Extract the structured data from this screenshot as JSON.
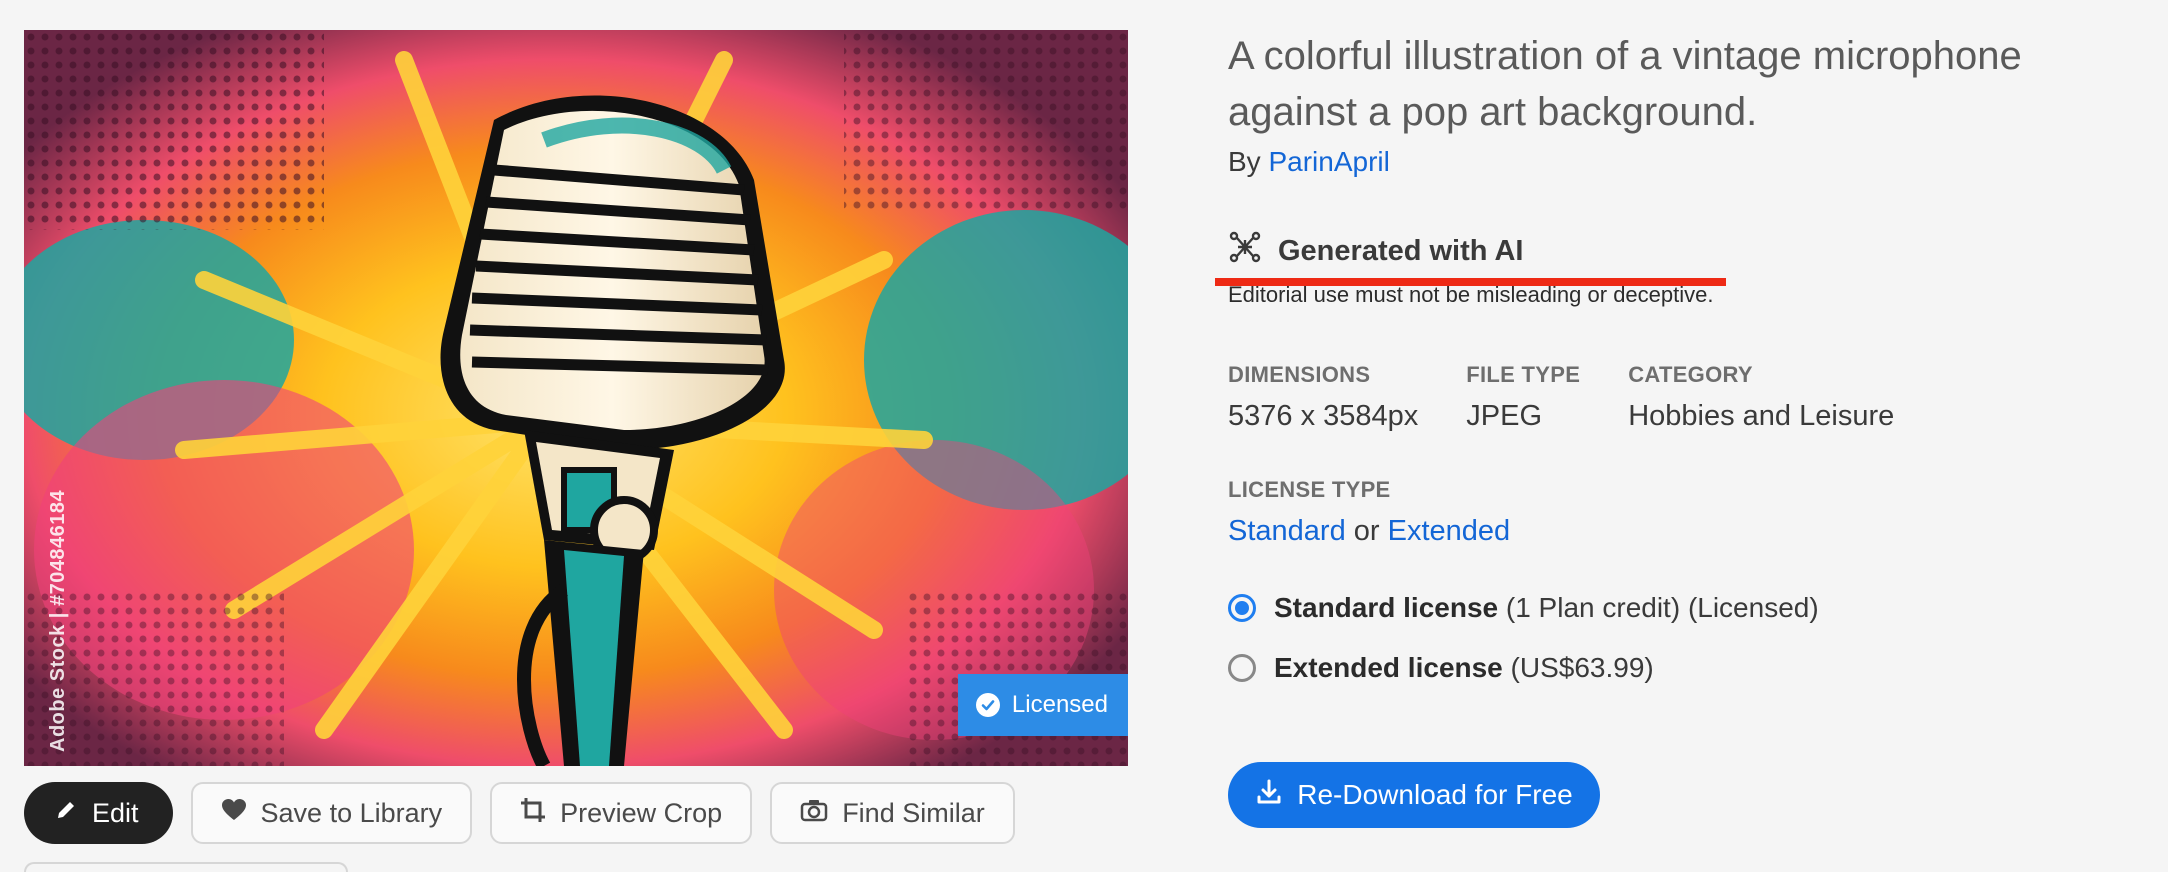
{
  "image": {
    "watermark": "Adobe Stock | #704846184",
    "licensed_badge": "Licensed"
  },
  "actions": {
    "edit": "Edit",
    "save": "Save to Library",
    "crop": "Preview Crop",
    "similar": "Find Similar"
  },
  "details": {
    "title": "A colorful illustration of a vintage microphone against a pop art background.",
    "by_prefix": "By",
    "author": "ParinApril",
    "ai_label": "Generated with AI",
    "notice": "Editorial use must not be misleading or deceptive.",
    "dimensions_label": "DIMENSIONS",
    "dimensions_value": "5376 x 3584px",
    "filetype_label": "FILE TYPE",
    "filetype_value": "JPEG",
    "category_label": "CATEGORY",
    "category_value": "Hobbies and Leisure",
    "license_type_label": "LICENSE TYPE",
    "license_standard": "Standard",
    "license_or": "or",
    "license_extended": "Extended"
  },
  "licenses": {
    "standard_name": "Standard license",
    "standard_note": "(1 Plan credit) (Licensed)",
    "extended_name": "Extended license",
    "extended_note": "(US$63.99)"
  },
  "cta": {
    "label": "Re-Download for Free"
  },
  "colors": {
    "accent": "#1473e6",
    "link": "#1366d6",
    "badge": "#2d8ce6",
    "highlight": "#ee2a15"
  }
}
